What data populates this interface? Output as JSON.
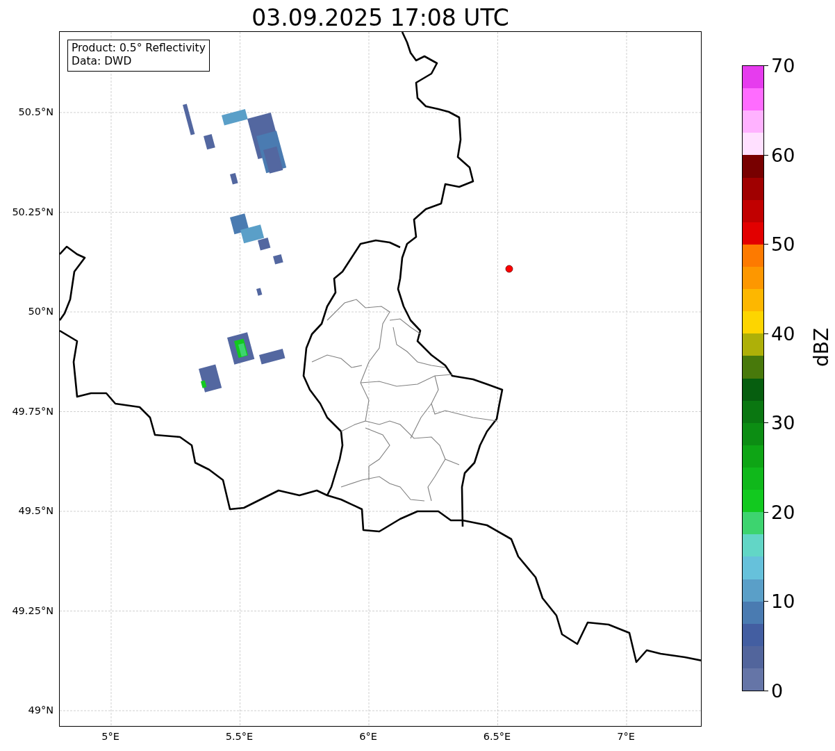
{
  "title": "03.09.2025 17:08 UTC",
  "info_box": {
    "lines": [
      "Product: 0.5° Reflectivity",
      "Data: DWD"
    ]
  },
  "map": {
    "y_ticks": [
      "50.5°N",
      "50.25°N",
      "50°N",
      "49.75°N",
      "49.5°N",
      "49.25°N",
      "49°N"
    ],
    "x_ticks": [
      "5°E",
      "5.5°E",
      "6°E",
      "6.5°E",
      "7°E"
    ]
  },
  "colorbar": {
    "label": "dBZ",
    "ticks": [
      "70",
      "60",
      "50",
      "40",
      "30",
      "20",
      "10",
      "0"
    ],
    "bins": [
      {
        "color": "#e63cee"
      },
      {
        "color": "#ff6cff"
      },
      {
        "color": "#ffb2ff"
      },
      {
        "color": "#ffe0ff"
      },
      {
        "color": "#780000"
      },
      {
        "color": "#a00000"
      },
      {
        "color": "#c10000"
      },
      {
        "color": "#e20000"
      },
      {
        "color": "#fd7a00"
      },
      {
        "color": "#fd9700"
      },
      {
        "color": "#fdb700"
      },
      {
        "color": "#fdd500"
      },
      {
        "color": "#aeb008"
      },
      {
        "color": "#48790b"
      },
      {
        "color": "#065e0f"
      },
      {
        "color": "#0a7711"
      },
      {
        "color": "#0c8d13"
      },
      {
        "color": "#0ea515"
      },
      {
        "color": "#10b81b"
      },
      {
        "color": "#12c91f"
      },
      {
        "color": "#3dd46f"
      },
      {
        "color": "#62d6c6"
      },
      {
        "color": "#66c1db"
      },
      {
        "color": "#5a9fc8"
      },
      {
        "color": "#4a7bb1"
      },
      {
        "color": "#435ea1"
      },
      {
        "color": "#52659c"
      },
      {
        "color": "#6575a7"
      }
    ]
  }
}
